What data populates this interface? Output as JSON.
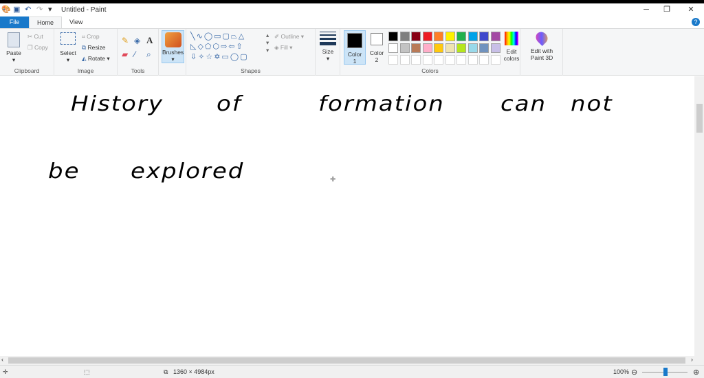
{
  "window": {
    "title": "Untitled - Paint",
    "minimize": "─",
    "restore": "❐",
    "close": "✕"
  },
  "tabs": [
    {
      "label": "File"
    },
    {
      "label": "Home"
    },
    {
      "label": "View"
    }
  ],
  "help": "?",
  "ribbon": {
    "clipboard": {
      "label": "Clipboard",
      "paste": "Paste",
      "cut": "Cut",
      "copy": "Copy"
    },
    "image": {
      "label": "Image",
      "select": "Select",
      "crop": "Crop",
      "resize": "Resize",
      "rotate": "Rotate"
    },
    "tools": {
      "label": "Tools"
    },
    "brushes": "Brushes",
    "shapes": {
      "label": "Shapes",
      "outline": "Outline",
      "fill": "Fill"
    },
    "size": "Size",
    "colors": {
      "label": "Colors",
      "color1": "Color",
      "color1_num": "1",
      "color2": "Color",
      "color2_num": "2",
      "edit": "Edit",
      "edit2": "colors",
      "row1": [
        "#000000",
        "#7f7f7f",
        "#880015",
        "#ed1c24",
        "#ff7f27",
        "#fff200",
        "#22b14c",
        "#00a2e8",
        "#3f48cc",
        "#a349a4"
      ],
      "row2": [
        "#ffffff",
        "#c3c3c3",
        "#b97a57",
        "#ffaec9",
        "#ffc90e",
        "#efe4b0",
        "#b5e61d",
        "#99d9ea",
        "#7092be",
        "#c8bfe7"
      ]
    },
    "paint3d": {
      "line1": "Edit with",
      "line2": "Paint 3D"
    }
  },
  "canvas": {
    "line1": [
      "History",
      "of",
      "formation",
      "can",
      "not"
    ],
    "line2": [
      "be",
      "explored"
    ]
  },
  "status": {
    "dimensions": "1360 × 4984px",
    "zoom": "100%"
  }
}
